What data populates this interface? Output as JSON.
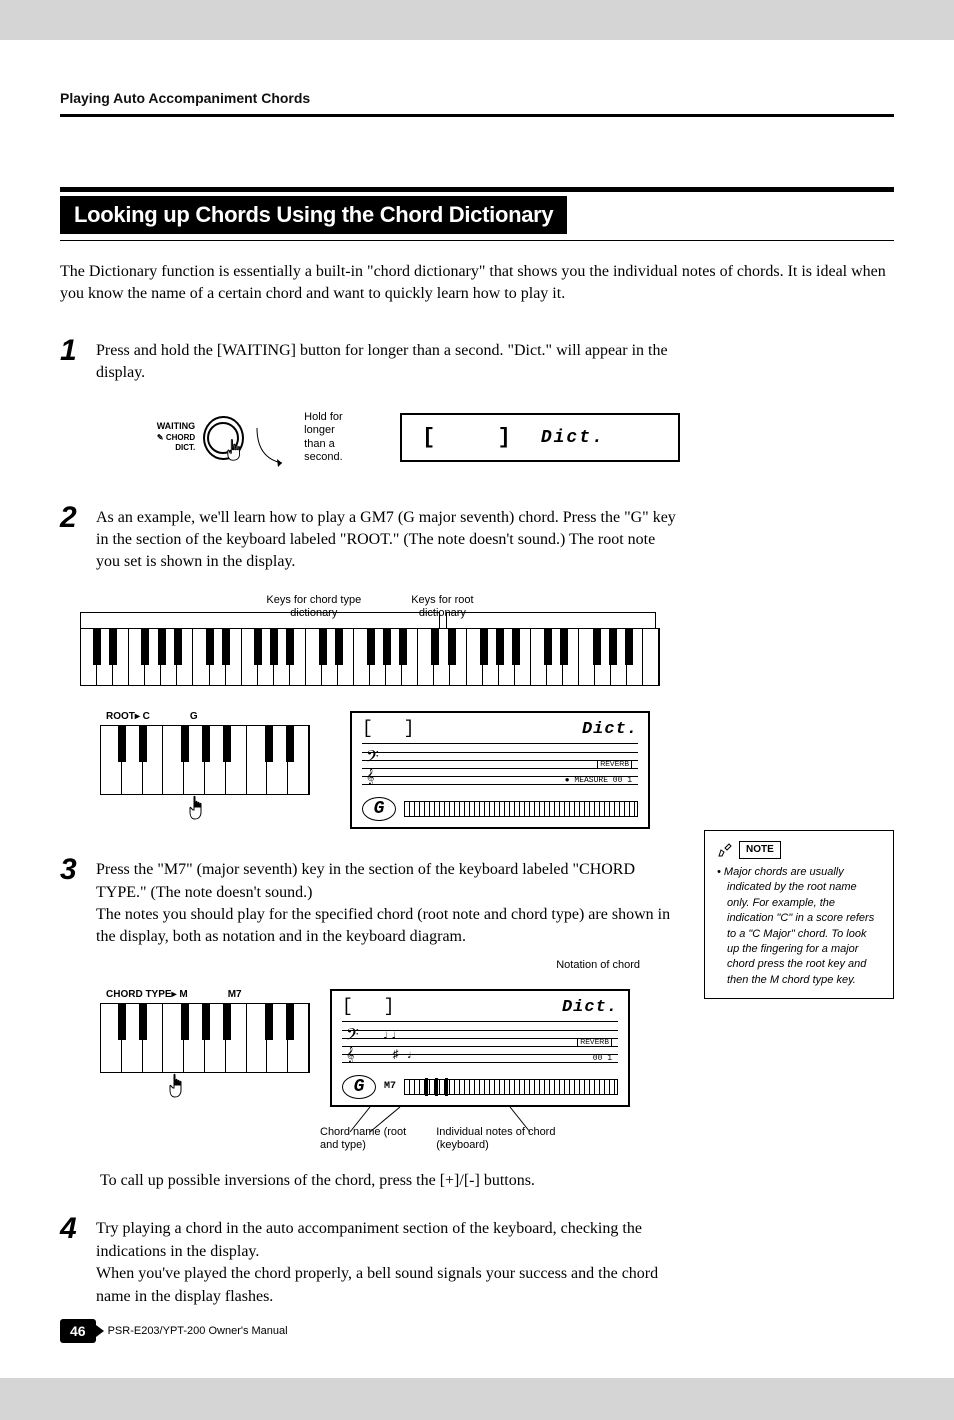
{
  "header": {
    "section_title": "Playing Auto Accompaniment Chords"
  },
  "main_heading": "Looking up Chords Using the Chord Dictionary",
  "intro": "The Dictionary function is essentially a built-in \"chord dictionary\" that shows you the individual notes of chords. It is ideal when you know the name of a certain chord and want to quickly learn how to play it.",
  "steps": {
    "1": {
      "text": "Press and hold the [WAITING] button for longer than a second. \"Dict.\" will appear in the display.",
      "button_label_top": "WAITING",
      "button_label_bottom": "CHORD DICT.",
      "hold_label": "Hold for longer\nthan a second.",
      "display_text": "Dict."
    },
    "2": {
      "text": "As an example, we'll learn how to play a GM7 (G major seventh) chord. Press the \"G\" key in the section of the keyboard labeled \"ROOT.\" (The note doesn't sound.) The root note you set is shown in the display.",
      "kb_label_left": "Keys for chord type\ndictionary",
      "kb_label_right": "Keys for root\ndictionary",
      "root_label": "ROOT▸ C",
      "root_key": "G",
      "lcd_title": "Dict.",
      "lcd_chord": "G",
      "lcd_reverb": "REVERB",
      "lcd_measure": "MEASURE 00 1"
    },
    "3": {
      "text": "Press the \"M7\" (major seventh) key in the section of the keyboard labeled \"CHORD TYPE.\" (The note doesn't sound.)\nThe notes you should play for the specified chord (root note and chord type) are shown in the display, both as notation and in the keyboard diagram.",
      "notation_caption": "Notation of chord",
      "chord_type_label": "CHORD TYPE▸ M",
      "chord_type_key": "M7",
      "lcd_title": "Dict.",
      "lcd_chord": "G",
      "lcd_chord_suffix": "M7",
      "lcd_reverb": "REVERB",
      "lcd_measure": "00 1",
      "caption_left": "Chord name (root\nand type)",
      "caption_right": "Individual notes of chord\n(keyboard)"
    },
    "inversion": "To call up possible inversions of the chord, press the [+]/[-] buttons.",
    "4": {
      "text": "Try playing a chord in the auto accompaniment section of the keyboard, checking the indications in the display.\nWhen you've played the chord properly, a bell sound signals your success and the chord name in the display flashes."
    }
  },
  "note_box": {
    "label": "NOTE",
    "text": "Major chords are usually indicated by the root name only. For example, the indication \"C\" in a score refers to a \"C Major\" chord. To look up the fingering for a major chord press the root key and then the M chord type key."
  },
  "footer": {
    "page_number": "46",
    "manual_name": "PSR-E203/YPT-200   Owner's Manual"
  }
}
